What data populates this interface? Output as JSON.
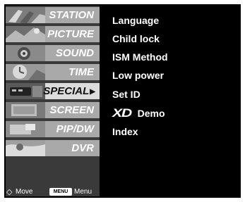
{
  "menu": {
    "items": [
      {
        "label": "STATION",
        "thumb": "station-thumbnail-icon"
      },
      {
        "label": "PICTURE",
        "thumb": "picture-thumbnail-icon"
      },
      {
        "label": "SOUND",
        "thumb": "sound-thumbnail-icon"
      },
      {
        "label": "TIME",
        "thumb": "time-thumbnail-icon"
      },
      {
        "label": "SPECIAL",
        "thumb": "special-thumbnail-icon",
        "selected": true
      },
      {
        "label": "SCREEN",
        "thumb": "screen-thumbnail-icon"
      },
      {
        "label": "PIP/DW",
        "thumb": "pip-thumbnail-icon"
      },
      {
        "label": "DVR",
        "thumb": "dvr-thumbnail-icon"
      }
    ],
    "selected_arrow": "▶"
  },
  "submenu": {
    "items": [
      {
        "label": "Language"
      },
      {
        "label": "Child lock"
      },
      {
        "label": "ISM Method"
      },
      {
        "label": "Low power"
      },
      {
        "label": "Set ID"
      },
      {
        "label": "Demo",
        "logo": "XD"
      },
      {
        "label": "Index"
      }
    ]
  },
  "footer": {
    "move_icon": "◇",
    "move_label": "Move",
    "menu_key": "MENU",
    "menu_label": "Menu"
  },
  "colors": {
    "background": "#000000",
    "menu_item": "#a9a9a9",
    "menu_item_selected": "#dcdcdc",
    "text": "#ffffff"
  }
}
